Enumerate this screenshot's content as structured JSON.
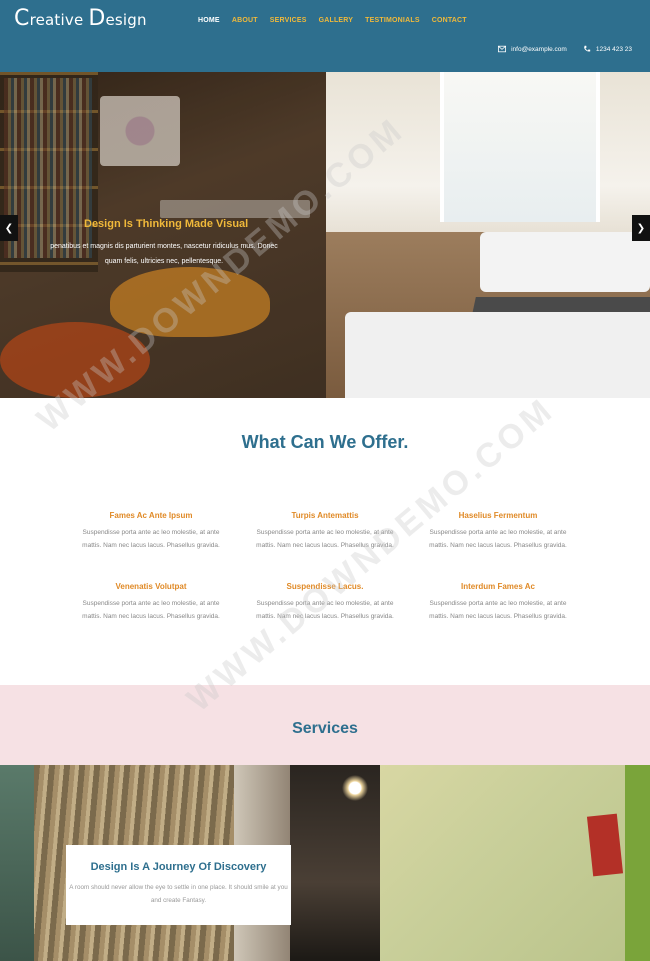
{
  "header": {
    "logo_first": "C",
    "logo_rest1": "reative ",
    "logo_d": "D",
    "logo_rest2": "esign",
    "nav": [
      "HOME",
      "ABOUT",
      "SERVICES",
      "GALLERY",
      "TESTIMONIALS",
      "CONTACT"
    ],
    "email": "info@example.com",
    "phone": "1234 423 23"
  },
  "hero": {
    "title": "Design Is Thinking Made Visual",
    "text": "penatibus et magnis dis parturient montes, nascetur ridiculus mus. Donec quam felis, ultricies nec, pellentesque.",
    "prev_icon": "chevron-left-icon",
    "next_icon": "chevron-right-icon"
  },
  "offer": {
    "title": "What Can We Offer.",
    "features": [
      {
        "title": "Fames Ac Ante Ipsum",
        "text": "Suspendisse porta ante ac leo molestie, at ante mattis. Nam nec lacus lacus. Phasellus gravida."
      },
      {
        "title": "Turpis Antemattis",
        "text": "Suspendisse porta ante ac leo molestie, at ante mattis. Nam nec lacus lacus. Phasellus gravida."
      },
      {
        "title": "Haselius Fermentum",
        "text": "Suspendisse porta ante ac leo molestie, at ante mattis. Nam nec lacus lacus. Phasellus gravida."
      },
      {
        "title": "Venenatis Volutpat",
        "text": "Suspendisse porta ante ac leo molestie, at ante mattis. Nam nec lacus lacus. Phasellus gravida."
      },
      {
        "title": "Suspendisse Lacus.",
        "text": "Suspendisse porta ante ac leo molestie, at ante mattis. Nam nec lacus lacus. Phasellus gravida."
      },
      {
        "title": "Interdum Fames Ac",
        "text": "Suspendisse porta ante ac leo molestie, at ante mattis. Nam nec lacus lacus. Phasellus gravida."
      }
    ]
  },
  "services": {
    "title": "Services",
    "card_title": "Design Is A Journey Of Discovery",
    "card_text": "A room should never allow the eye to settle in one place. It should smile at you and create Fantasy."
  },
  "watermark": "WWW.DOWNDEMO.COM",
  "colors": {
    "header": "#2e6f8e",
    "accent": "#f0b93a",
    "orange": "#e08a27",
    "pink_band": "#f6e1e4"
  }
}
